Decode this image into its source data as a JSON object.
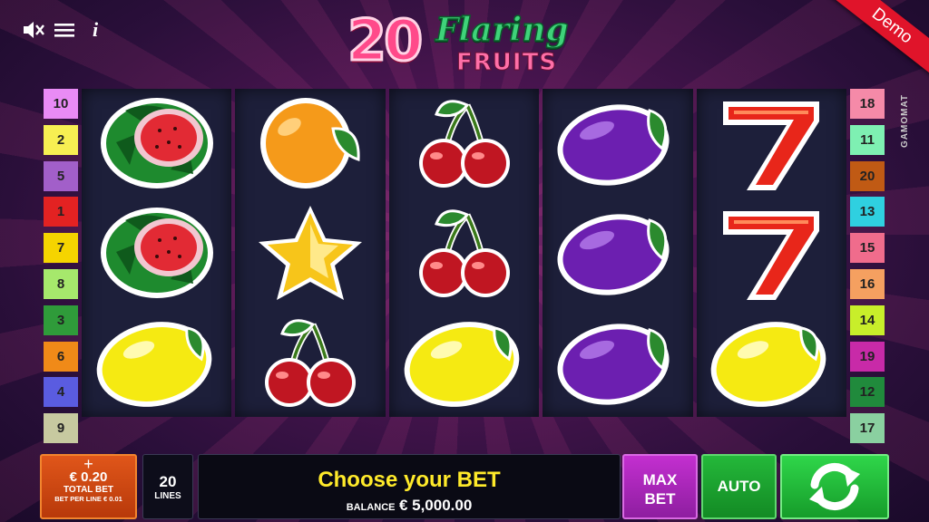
{
  "game": {
    "logo_number": "20",
    "logo_word1": "Flaring",
    "logo_word2": "FRUITS",
    "demo_label": "Demo",
    "brand": "GAMOMAT"
  },
  "top_icons": [
    "mute-icon",
    "menu-icon",
    "info-icon"
  ],
  "info_glyph": "i",
  "lines_left": [
    {
      "n": "10",
      "color": "#e98bf5"
    },
    {
      "n": "2",
      "color": "#f7ef52"
    },
    {
      "n": "5",
      "color": "#a25fc9"
    },
    {
      "n": "1",
      "color": "#e32222"
    },
    {
      "n": "7",
      "color": "#f5d400"
    },
    {
      "n": "8",
      "color": "#a6e86c"
    },
    {
      "n": "3",
      "color": "#2f9b3a"
    },
    {
      "n": "6",
      "color": "#f08a18"
    },
    {
      "n": "4",
      "color": "#5a5ce0"
    },
    {
      "n": "9",
      "color": "#c7c9a0"
    }
  ],
  "lines_right": [
    {
      "n": "18",
      "color": "#f58aa8"
    },
    {
      "n": "11",
      "color": "#7ef0b2"
    },
    {
      "n": "20",
      "color": "#c05a14"
    },
    {
      "n": "13",
      "color": "#2fd0e0"
    },
    {
      "n": "15",
      "color": "#f06c8c"
    },
    {
      "n": "16",
      "color": "#f5a060"
    },
    {
      "n": "14",
      "color": "#c8ee2a"
    },
    {
      "n": "19",
      "color": "#c82aa8"
    },
    {
      "n": "12",
      "color": "#208a3c"
    },
    {
      "n": "17",
      "color": "#8ad0a0"
    }
  ],
  "reels": [
    [
      "watermelon",
      "watermelon",
      "lemon"
    ],
    [
      "orange",
      "star",
      "cherry"
    ],
    [
      "cherry",
      "cherry",
      "lemon"
    ],
    [
      "plum",
      "plum",
      "plum"
    ],
    [
      "seven",
      "seven",
      "lemon"
    ]
  ],
  "bottom": {
    "bet_plus": "+",
    "bet_amount": "€ 0.20",
    "bet_label": "TOTAL BET",
    "bet_per_line": "BET PER LINE € 0.01",
    "lines_count": "20",
    "lines_label": "LINES",
    "message": "Choose your BET",
    "balance_label": "BALANCE",
    "balance_value": "€ 5,000.00",
    "maxbet_line1": "MAX",
    "maxbet_line2": "BET",
    "auto_label": "AUTO"
  }
}
